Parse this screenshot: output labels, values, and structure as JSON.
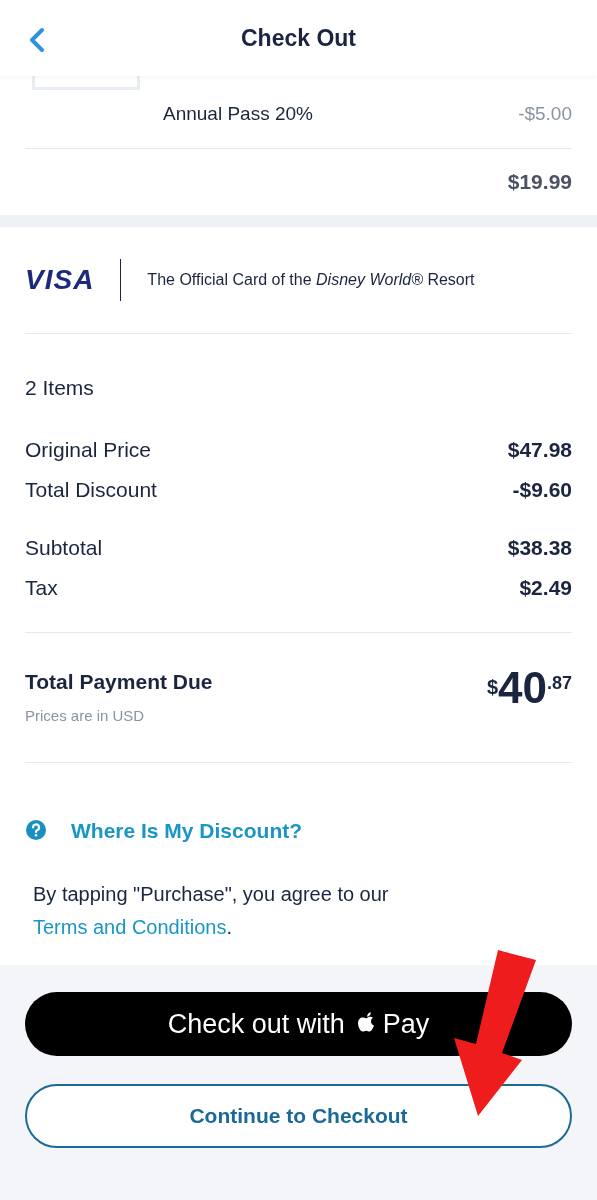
{
  "header": {
    "title": "Check Out"
  },
  "cart_item": {
    "discount_label": "Annual Pass 20%",
    "discount_amount": "-$5.00",
    "item_total": "$19.99"
  },
  "promo": {
    "brand": "VISA",
    "text": "The Official Card of the *Disney World®* Resort"
  },
  "summary": {
    "item_count": "2 Items",
    "groups": [
      [
        {
          "label": "Original Price",
          "value": "$47.98"
        },
        {
          "label": "Total Discount",
          "value": "-$9.60"
        }
      ],
      [
        {
          "label": "Subtotal",
          "value": "$38.38"
        },
        {
          "label": "Tax",
          "value": "$2.49"
        }
      ]
    ]
  },
  "total": {
    "label": "Total Payment Due",
    "note": "Prices are in USD",
    "currency": "$",
    "whole": "40",
    "cents": ".87"
  },
  "discount_link": "Where Is My Discount?",
  "terms": {
    "text": "By tapping \"Purchase\", you agree to our",
    "link": "Terms and Conditions",
    "end": "."
  },
  "apple_pay_button": {
    "before": "Check out with",
    "after": "Pay"
  },
  "checkout_button": "Continue to Checkout"
}
